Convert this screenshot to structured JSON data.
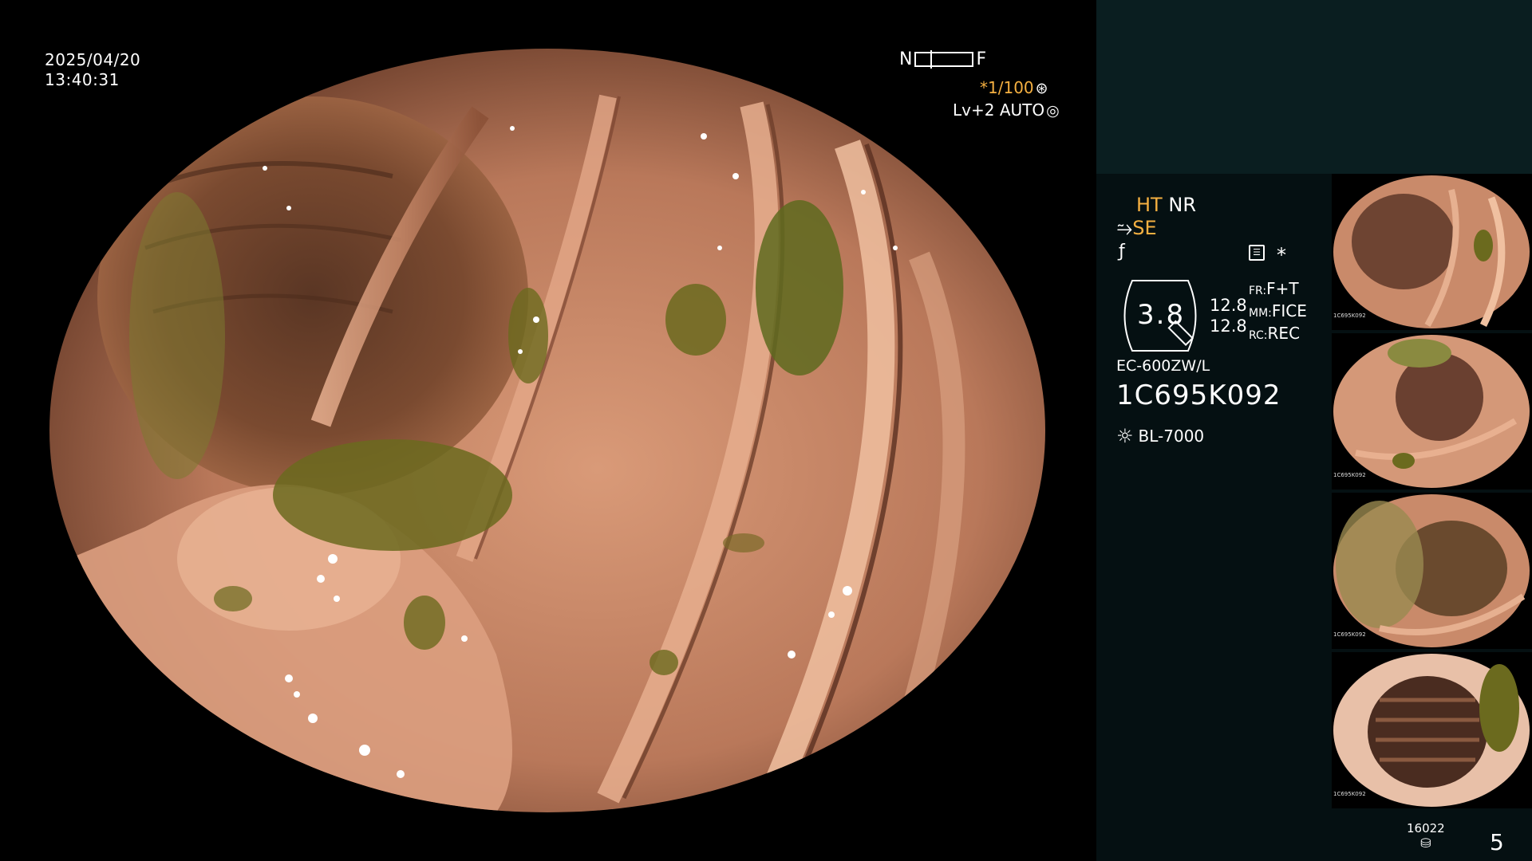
{
  "osd": {
    "date": "2025/04/20",
    "time": "13:40:31",
    "focus_near": "N",
    "focus_far": "F",
    "shutter": "*1/100",
    "level": "Lv+2 AUTO"
  },
  "panel": {
    "ht": "HT",
    "nr": "NR",
    "se": "SE",
    "zoom": "3.8",
    "value1": "12.8",
    "value2": "12.8",
    "fr_key": "FR:",
    "fr_val": "F+T",
    "mm_key": "MM:",
    "mm_val": "FICE",
    "rc_key": "RC:",
    "rc_val": "REC",
    "scope_model": "EC-600ZW/L",
    "serial": "1C695K092",
    "light_source": "BL-7000",
    "disk_count": "16022",
    "image_count": "5"
  },
  "thumbnails": [
    {
      "caption": "1C695K092"
    },
    {
      "caption": "1C695K092"
    },
    {
      "caption": "1C695K092"
    },
    {
      "caption": "1C695K092"
    }
  ],
  "colors": {
    "accent": "#f5b041",
    "panel_top": "#0a1e20",
    "panel": "#051012",
    "mucosa": "#c98a6a",
    "residue": "#6b6a1e"
  }
}
